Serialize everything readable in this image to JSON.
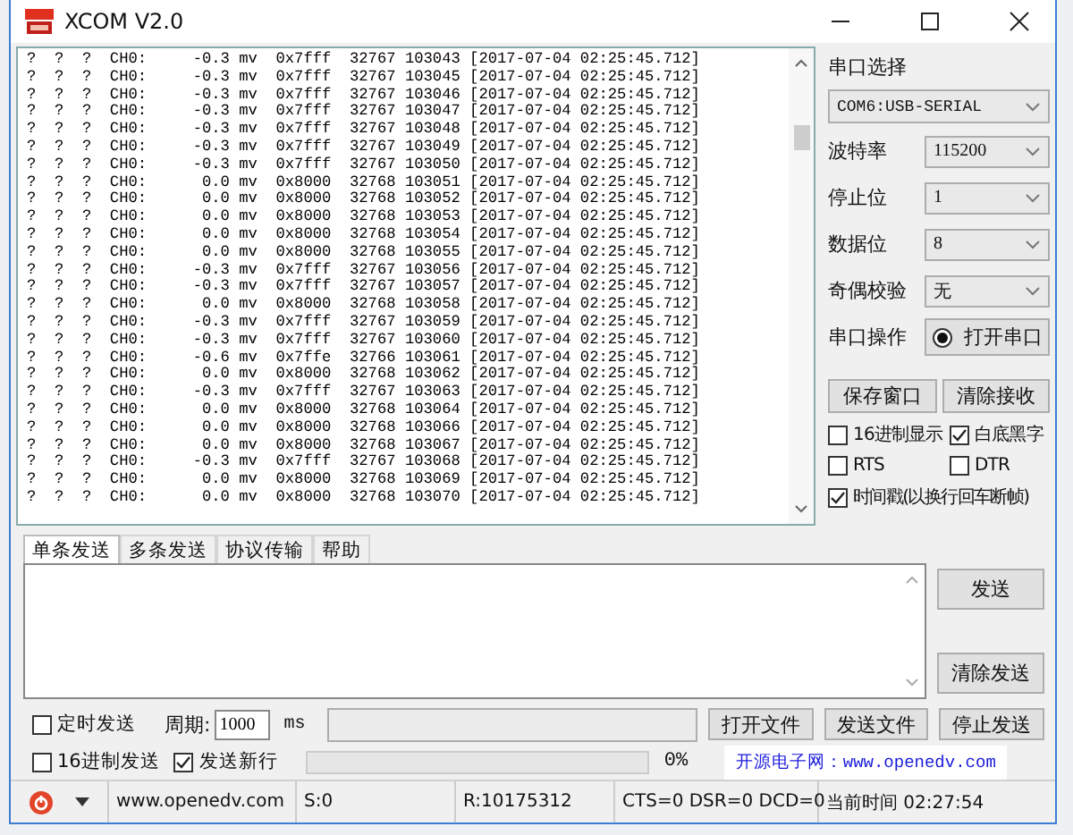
{
  "window": {
    "title": "XCOM V2.0"
  },
  "receive": {
    "lines": [
      "?  ?  ?  CH0:     -0.3 mv  0x7fff  32767 103043 [2017-07-04 02:25:45.712]",
      "?  ?  ?  CH0:     -0.3 mv  0x7fff  32767 103045 [2017-07-04 02:25:45.712]",
      "?  ?  ?  CH0:     -0.3 mv  0x7fff  32767 103046 [2017-07-04 02:25:45.712]",
      "?  ?  ?  CH0:     -0.3 mv  0x7fff  32767 103047 [2017-07-04 02:25:45.712]",
      "?  ?  ?  CH0:     -0.3 mv  0x7fff  32767 103048 [2017-07-04 02:25:45.712]",
      "?  ?  ?  CH0:     -0.3 mv  0x7fff  32767 103049 [2017-07-04 02:25:45.712]",
      "?  ?  ?  CH0:     -0.3 mv  0x7fff  32767 103050 [2017-07-04 02:25:45.712]",
      "?  ?  ?  CH0:      0.0 mv  0x8000  32768 103051 [2017-07-04 02:25:45.712]",
      "?  ?  ?  CH0:      0.0 mv  0x8000  32768 103052 [2017-07-04 02:25:45.712]",
      "?  ?  ?  CH0:      0.0 mv  0x8000  32768 103053 [2017-07-04 02:25:45.712]",
      "?  ?  ?  CH0:      0.0 mv  0x8000  32768 103054 [2017-07-04 02:25:45.712]",
      "?  ?  ?  CH0:      0.0 mv  0x8000  32768 103055 [2017-07-04 02:25:45.712]",
      "?  ?  ?  CH0:     -0.3 mv  0x7fff  32767 103056 [2017-07-04 02:25:45.712]",
      "?  ?  ?  CH0:     -0.3 mv  0x7fff  32767 103057 [2017-07-04 02:25:45.712]",
      "?  ?  ?  CH0:      0.0 mv  0x8000  32768 103058 [2017-07-04 02:25:45.712]",
      "?  ?  ?  CH0:     -0.3 mv  0x7fff  32767 103059 [2017-07-04 02:25:45.712]",
      "?  ?  ?  CH0:     -0.3 mv  0x7fff  32767 103060 [2017-07-04 02:25:45.712]",
      "?  ?  ?  CH0:     -0.6 mv  0x7ffe  32766 103061 [2017-07-04 02:25:45.712]",
      "?  ?  ?  CH0:      0.0 mv  0x8000  32768 103062 [2017-07-04 02:25:45.712]",
      "?  ?  ?  CH0:     -0.3 mv  0x7fff  32767 103063 [2017-07-04 02:25:45.712]",
      "?  ?  ?  CH0:      0.0 mv  0x8000  32768 103064 [2017-07-04 02:25:45.712]",
      "?  ?  ?  CH0:      0.0 mv  0x8000  32768 103066 [2017-07-04 02:25:45.712]",
      "?  ?  ?  CH0:      0.0 mv  0x8000  32768 103067 [2017-07-04 02:25:45.712]",
      "?  ?  ?  CH0:     -0.3 mv  0x7fff  32767 103068 [2017-07-04 02:25:45.712]",
      "?  ?  ?  CH0:      0.0 mv  0x8000  32768 103069 [2017-07-04 02:25:45.712]",
      "?  ?  ?  CH0:      0.0 mv  0x8000  32768 103070 [2017-07-04 02:25:45.712]"
    ]
  },
  "port_panel": {
    "title": "串口选择",
    "port": "COM6:USB-SERIAL",
    "settings": [
      {
        "label": "波特率",
        "value": "115200"
      },
      {
        "label": "停止位",
        "value": "1"
      },
      {
        "label": "数据位",
        "value": "8"
      },
      {
        "label": "奇偶校验",
        "value": "无"
      }
    ],
    "operation_label": "串口操作",
    "open_button": "打开串口",
    "buttons": [
      "保存窗口",
      "清除接收"
    ],
    "options": [
      {
        "label": "16进制显示",
        "checked": false
      },
      {
        "label": "白底黑字",
        "checked": true
      },
      {
        "label": "RTS",
        "checked": false
      },
      {
        "label": "DTR",
        "checked": false
      },
      {
        "label": "时间戳(以换行回车断帧)",
        "checked": true
      }
    ]
  },
  "tabs": [
    {
      "label": "单条发送",
      "selected": true
    },
    {
      "label": "多条发送",
      "selected": false
    },
    {
      "label": "协议传输",
      "selected": false
    },
    {
      "label": "帮助",
      "selected": false
    }
  ],
  "send": {
    "send_button": "发送",
    "clear_button": "清除发送",
    "timed": {
      "label": "定时发送",
      "checked": false
    },
    "period_label": "周期:",
    "period": "1000",
    "unit": "ms",
    "file_buttons": [
      "打开文件",
      "发送文件",
      "停止发送"
    ],
    "hex": {
      "label": "16进制发送",
      "checked": false
    },
    "newline": {
      "label": "发送新行",
      "checked": true
    },
    "progress": {
      "level": 0,
      "reading": "0%"
    },
    "ad": "开源电子网：www.openedv.com"
  },
  "status_bar": {
    "link": "www.openedv.com",
    "sent": "S:0",
    "received": "R:10175312",
    "lines": "CTS=0 DSR=0 DCD=0",
    "time": "当前时间 02:27:54"
  }
}
